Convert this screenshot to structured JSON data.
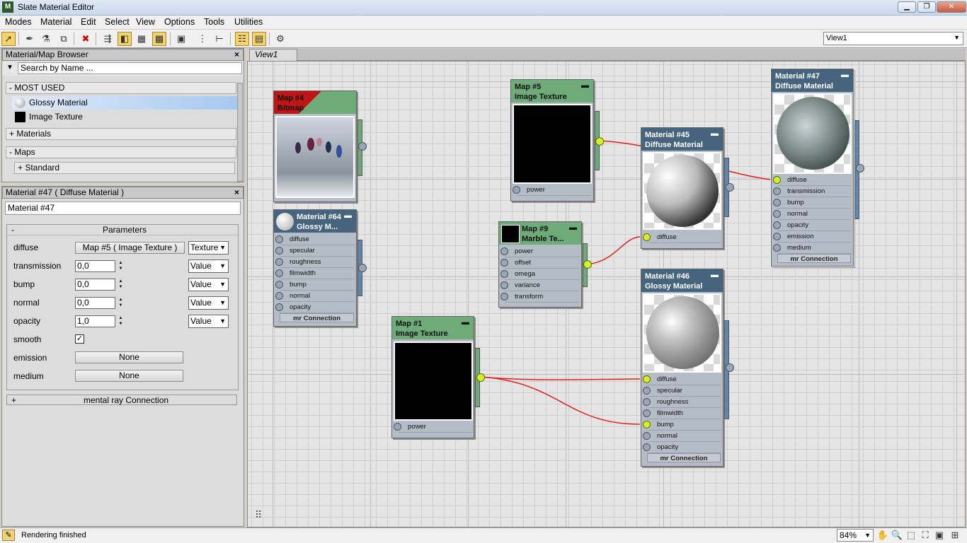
{
  "window": {
    "title": "Slate Material Editor",
    "icon_text": "M",
    "btn_minimize": "▁",
    "btn_maximize": "❐",
    "btn_close": "✕"
  },
  "menu": [
    "Modes",
    "Material",
    "Edit",
    "Select",
    "View",
    "Options",
    "Tools",
    "Utilities"
  ],
  "toolbar": {
    "icons": [
      "select-arrow-icon",
      "eyedropper-icon",
      "pick-material-icon",
      "assign-material-icon",
      "delete-icon",
      "move-children-icon",
      "hide-unused-slots-icon",
      "background-icon",
      "checker-icon",
      "show-map-icon",
      "layout-all-icon",
      "layout-children-icon",
      "material-map-browser-icon",
      "parameter-editor-icon",
      "select-by-material-icon"
    ],
    "view_select": "View1"
  },
  "browser": {
    "title": "Material/Map Browser",
    "close": "×",
    "search_placeholder": "Search by Name ...",
    "groups": {
      "most_used": "- MOST USED",
      "materials": "+ Materials",
      "maps": "- Maps",
      "standard": "+ Standard"
    },
    "items": [
      {
        "label": "Glossy Material"
      },
      {
        "label": "Image Texture"
      }
    ]
  },
  "params": {
    "title": "Material #47  ( Diffuse Material )",
    "close": "×",
    "name": "Material #47",
    "group_toggle": "-",
    "group_title": "Parameters",
    "rows": {
      "diffuse": {
        "label": "diffuse",
        "map": "Map #5  ( Image Texture )",
        "type": "Texture"
      },
      "transmission": {
        "label": "transmission",
        "value": "0,0",
        "type": "Value"
      },
      "bump": {
        "label": "bump",
        "value": "0,0",
        "type": "Value"
      },
      "normal": {
        "label": "normal",
        "value": "0,0",
        "type": "Value"
      },
      "opacity": {
        "label": "opacity",
        "value": "1,0",
        "type": "Value"
      },
      "smooth": {
        "label": "smooth",
        "checked": true,
        "mark": "✓"
      },
      "emission": {
        "label": "emission",
        "map": "None"
      },
      "medium": {
        "label": "medium",
        "map": "None"
      }
    },
    "connection_toggle": "+",
    "connection": "mental ray Connection"
  },
  "view": {
    "tab": "View1"
  },
  "nodes": {
    "map4": {
      "title1": "Map #4",
      "title2": "Bitmap"
    },
    "mat64": {
      "title1": "Material #64",
      "title2": "Glossy M...",
      "slots": [
        "diffuse",
        "specular",
        "roughness",
        "filmwidth",
        "bump",
        "normal",
        "opacity"
      ],
      "footer": "mr Connection"
    },
    "map5": {
      "title1": "Map #5",
      "title2": "Image Texture",
      "slots": [
        "power"
      ]
    },
    "map9": {
      "title1": "Map #9",
      "title2": "Marble Te...",
      "slots": [
        "power",
        "offset",
        "omega",
        "variance",
        "transform"
      ]
    },
    "mat45": {
      "title1": "Material #45",
      "title2": "Diffuse Material",
      "slots": [
        "diffuse"
      ]
    },
    "mat47": {
      "title1": "Material #47",
      "title2": "Diffuse Material",
      "slots": [
        "diffuse",
        "transmission",
        "bump",
        "normal",
        "opacity",
        "emission",
        "medium"
      ],
      "footer": "mr Connection"
    },
    "map1": {
      "title1": "Map #1",
      "title2": "Image Texture",
      "slots": [
        "power"
      ]
    },
    "mat46": {
      "title1": "Material #46",
      "title2": "Glossy Material",
      "slots": [
        "diffuse",
        "specular",
        "roughness",
        "filmwidth",
        "bump",
        "normal",
        "opacity"
      ],
      "footer": "mr Connection"
    }
  },
  "status": {
    "text": "Rendering finished",
    "zoom": "84%"
  },
  "colors": {
    "map_header": "#6eab78",
    "material_header": "#46647e",
    "wire": "#e02020",
    "socket_active": "#d7f020",
    "selection": "#a7c8ef"
  }
}
